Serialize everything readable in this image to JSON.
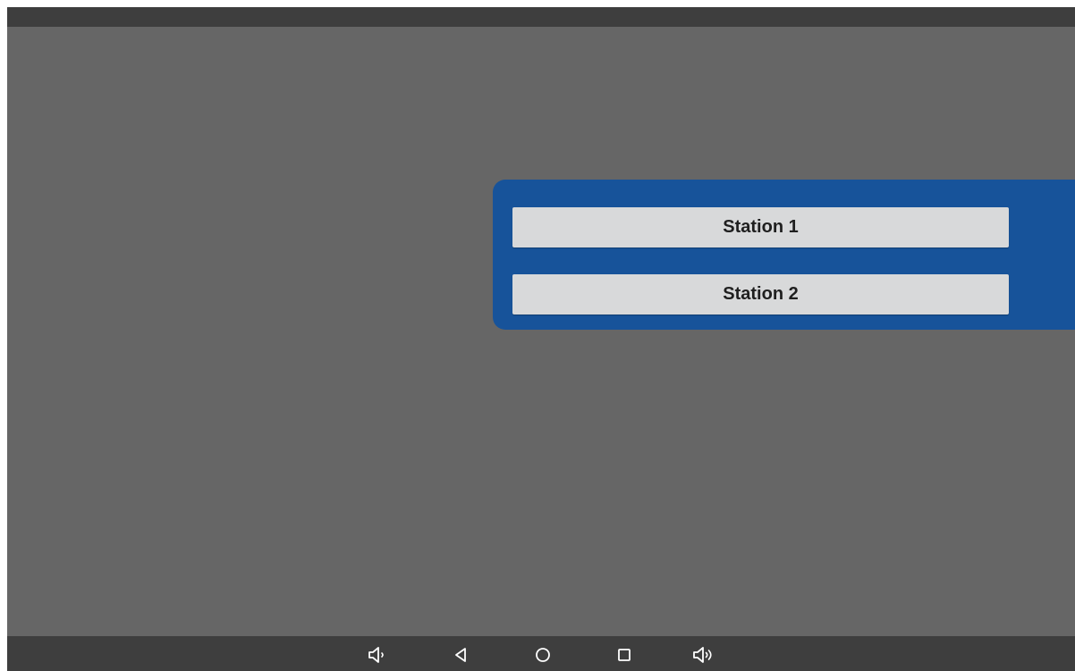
{
  "stations": {
    "items": [
      {
        "label": "Station 1"
      },
      {
        "label": "Station 2"
      }
    ]
  },
  "navigation": {
    "icons": [
      "volume-down-icon",
      "back-icon",
      "home-icon",
      "recent-apps-icon",
      "volume-up-icon"
    ]
  },
  "colors": {
    "screen_background": "#666666",
    "system_bar": "#3E3E3E",
    "station_panel": "#17539A",
    "station_button": "#D8D9DA",
    "station_button_text": "#1F1F1F"
  }
}
